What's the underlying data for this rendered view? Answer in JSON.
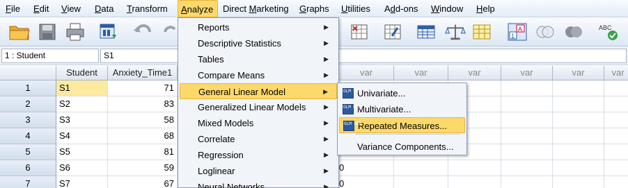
{
  "menubar": {
    "items": [
      {
        "label": "File",
        "u": "F",
        "rest": "ile"
      },
      {
        "label": "Edit",
        "u": "E",
        "rest": "dit"
      },
      {
        "label": "View",
        "u": "V",
        "rest": "iew"
      },
      {
        "label": "Data",
        "u": "D",
        "rest": "ata"
      },
      {
        "label": "Transform",
        "u": "T",
        "rest": "ransform"
      },
      {
        "label": "Analyze",
        "u": "A",
        "rest": "nalyze"
      },
      {
        "label": "Direct Marketing",
        "pre": "Direct ",
        "u": "M",
        "rest": "arketing"
      },
      {
        "label": "Graphs",
        "u": "G",
        "rest": "raphs"
      },
      {
        "label": "Utilities",
        "u": "U",
        "rest": "tilities"
      },
      {
        "label": "Add-ons",
        "pre": "A",
        "u": "d",
        "rest": "d-ons"
      },
      {
        "label": "Window",
        "u": "W",
        "rest": "indow"
      },
      {
        "label": "Help",
        "u": "H",
        "rest": "elp"
      }
    ]
  },
  "toolbar": {
    "icons": [
      "open-icon",
      "save-icon",
      "print-icon",
      "dialog-recall-icon",
      "undo-icon",
      "redo-icon",
      "goto-case-icon",
      "goto-variable-icon",
      "variables-icon",
      "split-file-icon",
      "weight-cases-icon",
      "select-cases-icon",
      "value-labels-icon",
      "use-variable-sets-icon",
      "show-all-variables-icon",
      "spelling-icon"
    ]
  },
  "locator": {
    "name": "1 : Student",
    "value": "S1"
  },
  "grid": {
    "columns": [
      "Student",
      "Anxiety_Time1",
      "var",
      "var",
      "var",
      "var",
      "var",
      "var",
      "var",
      "var"
    ],
    "rows": [
      {
        "n": "1",
        "student": "S1",
        "anxiety": "71"
      },
      {
        "n": "2",
        "student": "S2",
        "anxiety": "83"
      },
      {
        "n": "3",
        "student": "S3",
        "anxiety": "58"
      },
      {
        "n": "4",
        "student": "S4",
        "anxiety": "68"
      },
      {
        "n": "5",
        "student": "S5",
        "anxiety": "81"
      },
      {
        "n": "6",
        "student": "S6",
        "anxiety": "59"
      },
      {
        "n": "7",
        "student": "S7",
        "anxiety": "67"
      }
    ],
    "partial_values": {
      "row6": "0",
      "row7": "0"
    }
  },
  "analyze_menu": {
    "items": [
      {
        "label": "Reports",
        "has_sub": true
      },
      {
        "label": "Descriptive Statistics",
        "has_sub": true
      },
      {
        "label": "Tables",
        "has_sub": true
      },
      {
        "label": "Compare Means",
        "has_sub": true
      },
      {
        "label": "General Linear Model",
        "has_sub": true
      },
      {
        "label": "Generalized Linear Models",
        "has_sub": true
      },
      {
        "label": "Mixed Models",
        "has_sub": true
      },
      {
        "label": "Correlate",
        "has_sub": true
      },
      {
        "label": "Regression",
        "has_sub": true
      },
      {
        "label": "Loglinear",
        "has_sub": true
      },
      {
        "label": "Neural Networks",
        "has_sub": true
      }
    ],
    "active_index": 4
  },
  "glm_submenu": {
    "items": [
      {
        "label": "Univariate...",
        "icon": "univariate-icon",
        "icon_text": "GLM UNI"
      },
      {
        "label": "Multivariate...",
        "icon": "multivariate-icon",
        "icon_text": "GLM MUL"
      },
      {
        "label": "Repeated Measures...",
        "icon": "repeated-measures-icon",
        "icon_text": "GLM REP"
      },
      {
        "label": "Variance Components...",
        "icon": "",
        "icon_text": ""
      }
    ],
    "active_index": 2
  },
  "colors": {
    "highlight": "#fdd96c",
    "selected_cell": "#fdeaa0",
    "menu_bg": "#f1f4f9",
    "glm_icon": "#2c5aa0"
  }
}
